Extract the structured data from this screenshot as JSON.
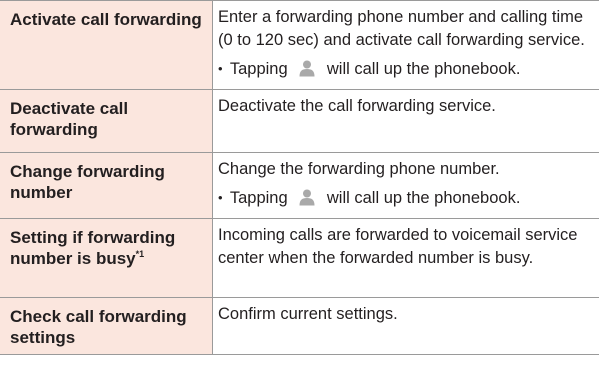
{
  "colors": {
    "label_background": "#fbe6de",
    "rule": "#9a9a9a",
    "text": "#231f20"
  },
  "rows": [
    {
      "label": "Activate call forwarding",
      "description": "Enter a forwarding phone number and calling time (0 to 120 sec) and activate call forwarding service.",
      "note": {
        "bullet": "•",
        "before": "Tapping",
        "icon": "person-icon",
        "after": "will call up the phonebook."
      }
    },
    {
      "label": "Deactivate call forwarding",
      "description": "Deactivate the call forwarding service."
    },
    {
      "label": "Change forwarding number",
      "description": "Change the forwarding phone number.",
      "note": {
        "bullet": "•",
        "before": "Tapping",
        "icon": "person-icon",
        "after": "will call up the phonebook."
      }
    },
    {
      "label": "Setting if forwarding number is busy",
      "footnote_mark": "*1",
      "description": "Incoming calls are forwarded to voicemail service center when the forwarded number is busy."
    },
    {
      "label": "Check call forwarding settings",
      "description": "Confirm current settings."
    }
  ]
}
